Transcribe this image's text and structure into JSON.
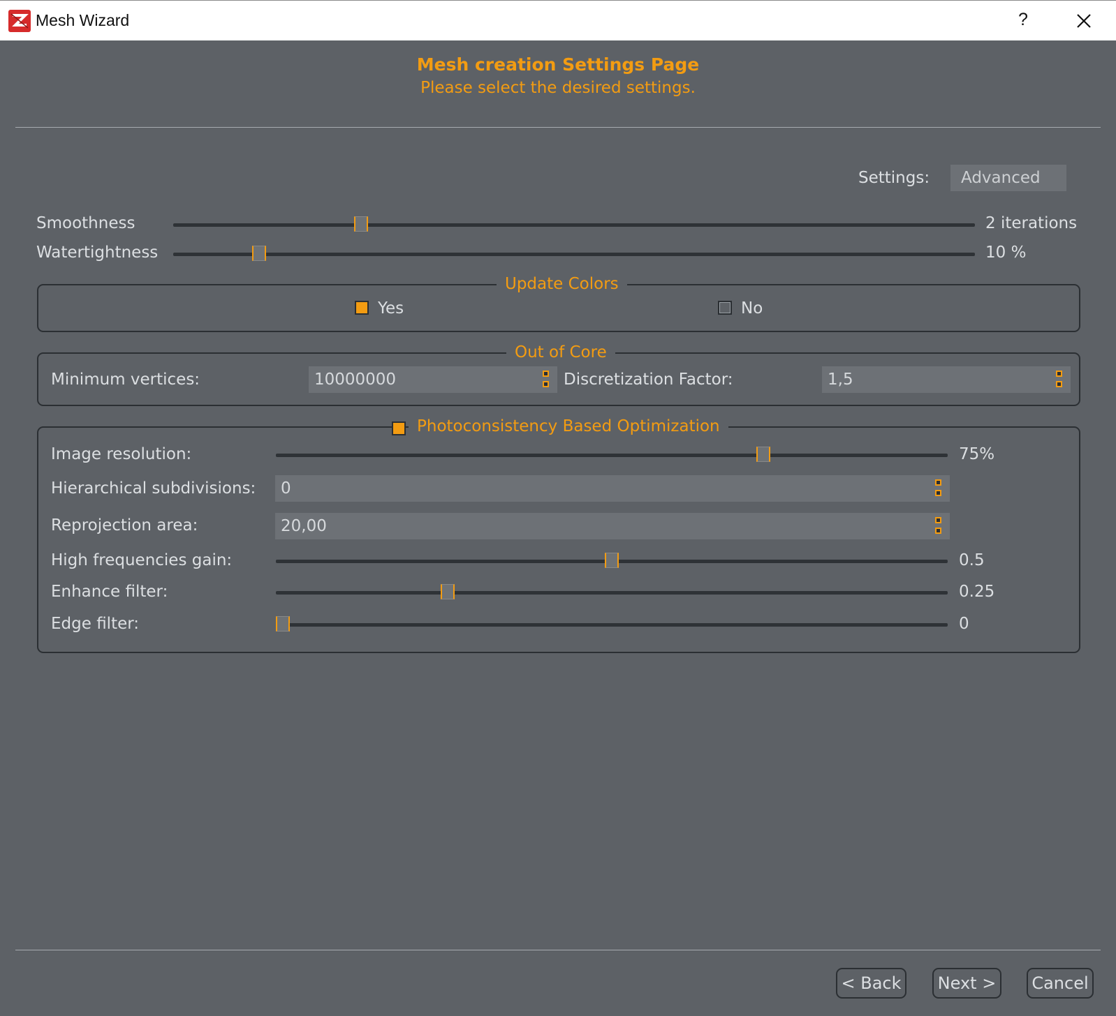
{
  "window": {
    "title": "Mesh Wizard",
    "help_label": "?",
    "icon": "app-logo-icon"
  },
  "header": {
    "title": "Mesh creation Settings Page",
    "subtitle": "Please select the desired settings."
  },
  "settings": {
    "label": "Settings:",
    "selected": "Advanced"
  },
  "smoothness": {
    "label": "Smoothness",
    "value_text": "2 iterations",
    "level": 0.23
  },
  "watertightness": {
    "label": "Watertightness",
    "value_text": "10 %",
    "level": 0.1
  },
  "update_colors": {
    "title": "Update Colors",
    "options": [
      {
        "label": "Yes",
        "checked": true
      },
      {
        "label": "No",
        "checked": false
      }
    ]
  },
  "out_of_core": {
    "title": "Out of Core",
    "min_vertices_label": "Minimum vertices:",
    "min_vertices_value": "10000000",
    "discretization_label": "Discretization Factor:",
    "discretization_value": "1,5"
  },
  "photo": {
    "title": "Photoconsistency Based Optimization",
    "enabled": true,
    "image_resolution": {
      "label": "Image resolution:",
      "value_text": "75%",
      "level": 0.73
    },
    "hierarchical": {
      "label": "Hierarchical subdivisions:",
      "value": "0"
    },
    "reprojection": {
      "label": "Reprojection area:",
      "value": "20,00"
    },
    "hf_gain": {
      "label": "High frequencies gain:",
      "value_text": "0.5",
      "level": 0.5
    },
    "enhance": {
      "label": "Enhance filter:",
      "value_text": "0.25",
      "level": 0.25
    },
    "edge": {
      "label": "Edge filter:",
      "value_text": "0",
      "level": 0
    }
  },
  "footer": {
    "back": "< Back",
    "next": "Next >",
    "cancel": "Cancel"
  },
  "colors": {
    "accent": "#f39c12",
    "background": "#5d6166",
    "text": "#dcdfe2"
  }
}
